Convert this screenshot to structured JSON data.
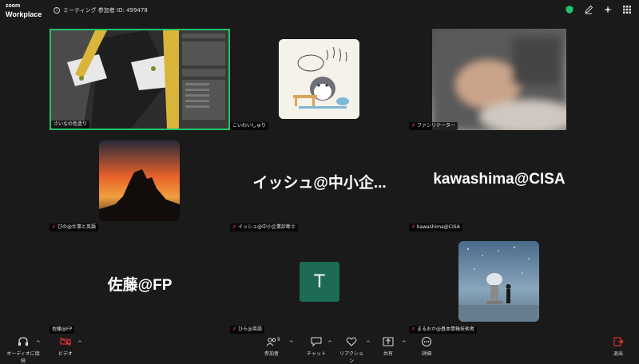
{
  "app": {
    "logo_top": "zoom",
    "logo_bottom": "Workplace"
  },
  "meeting": {
    "info": "ミーティング 参加者 ID: 499478"
  },
  "top_icons": [
    "shield-icon",
    "pen-icon",
    "sparkle-icon",
    "grid-icon"
  ],
  "participants": [
    {
      "name": "さいなの色塗り",
      "type": "video",
      "muted": false,
      "active_speaker": true
    },
    {
      "name": "こいわいしゅり",
      "type": "avatar",
      "muted": false
    },
    {
      "name": "ファシリテーター",
      "type": "video",
      "muted": true
    },
    {
      "name": "ぴの@仕事と英語",
      "type": "avatar",
      "muted": true
    },
    {
      "name": "イッシュ@中小企業診断士",
      "display": "イッシュ@中小企...",
      "type": "name",
      "muted": true
    },
    {
      "name": "kawashima@CISA",
      "display": "kawashima@CISA",
      "type": "name",
      "muted": true
    },
    {
      "name": "佐藤@FP",
      "display": "佐藤@FP",
      "type": "name",
      "muted": false
    },
    {
      "name": "ひら@英語",
      "initial": "T",
      "type": "initial",
      "muted": true,
      "initial_color": "#1e6b55"
    },
    {
      "name": "まるおか@基本情報技術者",
      "type": "avatar",
      "muted": true
    }
  ],
  "toolbar": {
    "audio": "オーディオに接続",
    "video": "ビデオ",
    "participants": "参加者",
    "participant_count": "9",
    "chat": "チャット",
    "reactions": "リアクション",
    "share": "共有",
    "more": "詳細",
    "leave": "退出"
  }
}
